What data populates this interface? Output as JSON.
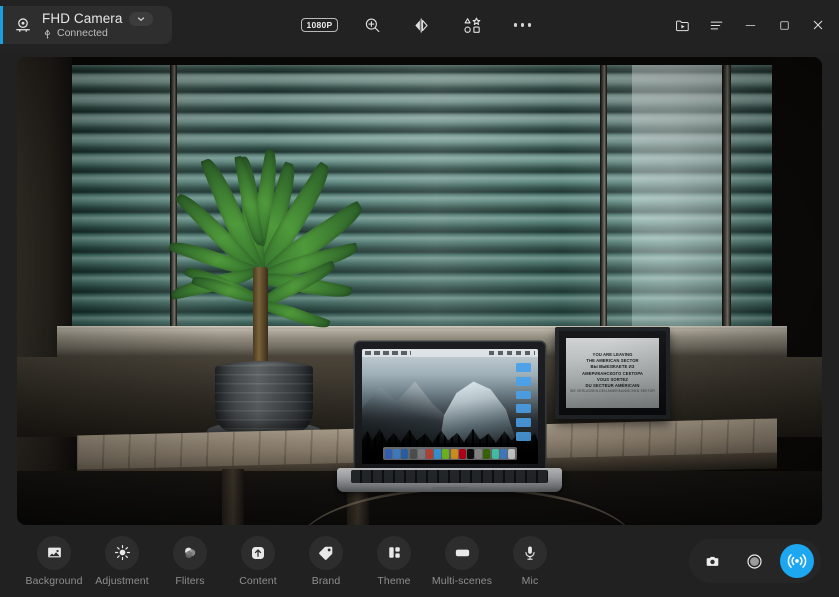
{
  "app": {
    "accent_color": "#1ca7f0",
    "window_bg": "#212121",
    "titlebar_bg": "#222222"
  },
  "titlebar": {
    "device": {
      "icon": "camera-icon",
      "name": "FHD Camera",
      "dropdown_icon": "chevron-down-icon",
      "connection_icon": "usb-icon",
      "status": "Connected",
      "accent_color": "#1b9fe0"
    },
    "tools": [
      {
        "id": "resolution",
        "label": "1080P",
        "icon": "resolution-badge",
        "name": "resolution-badge"
      },
      {
        "id": "zoom",
        "label": "",
        "icon": "zoom-in-icon",
        "name": "zoom-in-button"
      },
      {
        "id": "mirror",
        "label": "",
        "icon": "mirror-flip-icon",
        "name": "mirror-flip-button"
      },
      {
        "id": "shapes",
        "label": "",
        "icon": "shapes-icon",
        "name": "shapes-button"
      },
      {
        "id": "more",
        "label": "",
        "icon": "more-horizontal-icon",
        "name": "more-options-button"
      }
    ],
    "window_controls": [
      {
        "id": "media",
        "icon": "folder-play-icon",
        "name": "media-folder-button"
      },
      {
        "id": "menu",
        "icon": "hamburger-menu-icon",
        "name": "main-menu-button"
      },
      {
        "id": "minimize",
        "icon": "minimize-icon",
        "name": "minimize-button"
      },
      {
        "id": "maximize",
        "icon": "maximize-icon",
        "name": "maximize-button"
      },
      {
        "id": "close",
        "icon": "close-icon",
        "name": "close-button"
      }
    ]
  },
  "preview": {
    "description": "Live camera preview: a potted dracaena plant on a wooden windowsill beside a MacBook laptop showing the OS X Yosemite Half Dome wallpaper, with teal venetian blinds filling the window behind and a framed Checkpoint Charlie sign on the right.",
    "framed_sign": {
      "line1": "YOU ARE LEAVING",
      "line2": "THE AMERICAN SECTOR",
      "line3": "ВЫ ВЫЕЗЖАЕТЕ ИЗ",
      "line4": "АМЕРИКАНСКОГО СЕКТОРА",
      "line5": "VOUS SORTEZ",
      "line6": "DU SECTEUR AMÉRICAIN",
      "line7": "SIE VERLASSEN DEN AMERIKANISCHEN SEKTOR"
    }
  },
  "bottombar": {
    "features": [
      {
        "label": "Background",
        "icon": "image-icon",
        "name": "background-button"
      },
      {
        "label": "Adjustment",
        "icon": "brightness-icon",
        "name": "adjustment-button"
      },
      {
        "label": "Fliters",
        "icon": "filters-icon",
        "name": "filters-button"
      },
      {
        "label": "Content",
        "icon": "upload-icon",
        "name": "content-button"
      },
      {
        "label": "Brand",
        "icon": "tag-icon",
        "name": "brand-button"
      },
      {
        "label": "Theme",
        "icon": "layout-icon",
        "name": "theme-button"
      },
      {
        "label": "Multi-scenes",
        "icon": "scenes-icon",
        "name": "multi-scenes-button"
      },
      {
        "label": "Mic",
        "icon": "microphone-icon",
        "name": "mic-button"
      }
    ],
    "actions": [
      {
        "id": "snapshot",
        "icon": "camera-shutter-icon",
        "name": "snapshot-button",
        "active": false
      },
      {
        "id": "record",
        "icon": "record-circle-icon",
        "name": "record-button",
        "active": false
      },
      {
        "id": "livestream",
        "icon": "broadcast-icon",
        "name": "live-stream-button",
        "active": true,
        "color": "#1ca7f0"
      }
    ]
  }
}
